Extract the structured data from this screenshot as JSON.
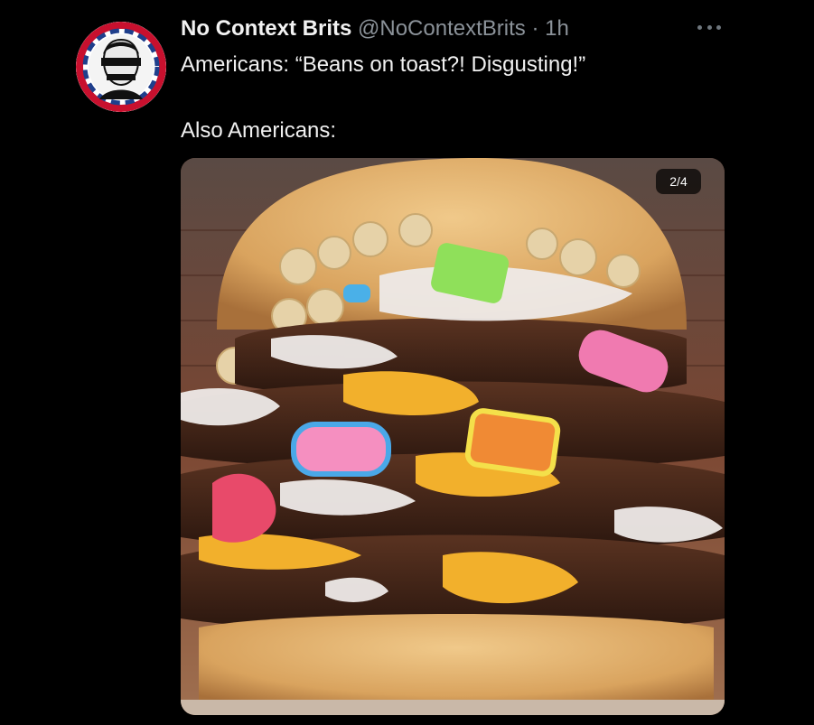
{
  "tweet": {
    "display_name": "No Context Brits",
    "handle": "@NoContextBrits",
    "separator": "·",
    "time": "1h",
    "line1": "Americans: “Beans on toast?! Disgusting!”",
    "line2": "Also Americans:",
    "media_counter": "2/4",
    "avatar_icon": "punk-queen-portrait-icon",
    "more_icon": "more-options-icon"
  },
  "colors": {
    "background": "#000000",
    "name": "#f2f2f2",
    "muted": "#8b9299",
    "text": "#f1f1f1"
  }
}
